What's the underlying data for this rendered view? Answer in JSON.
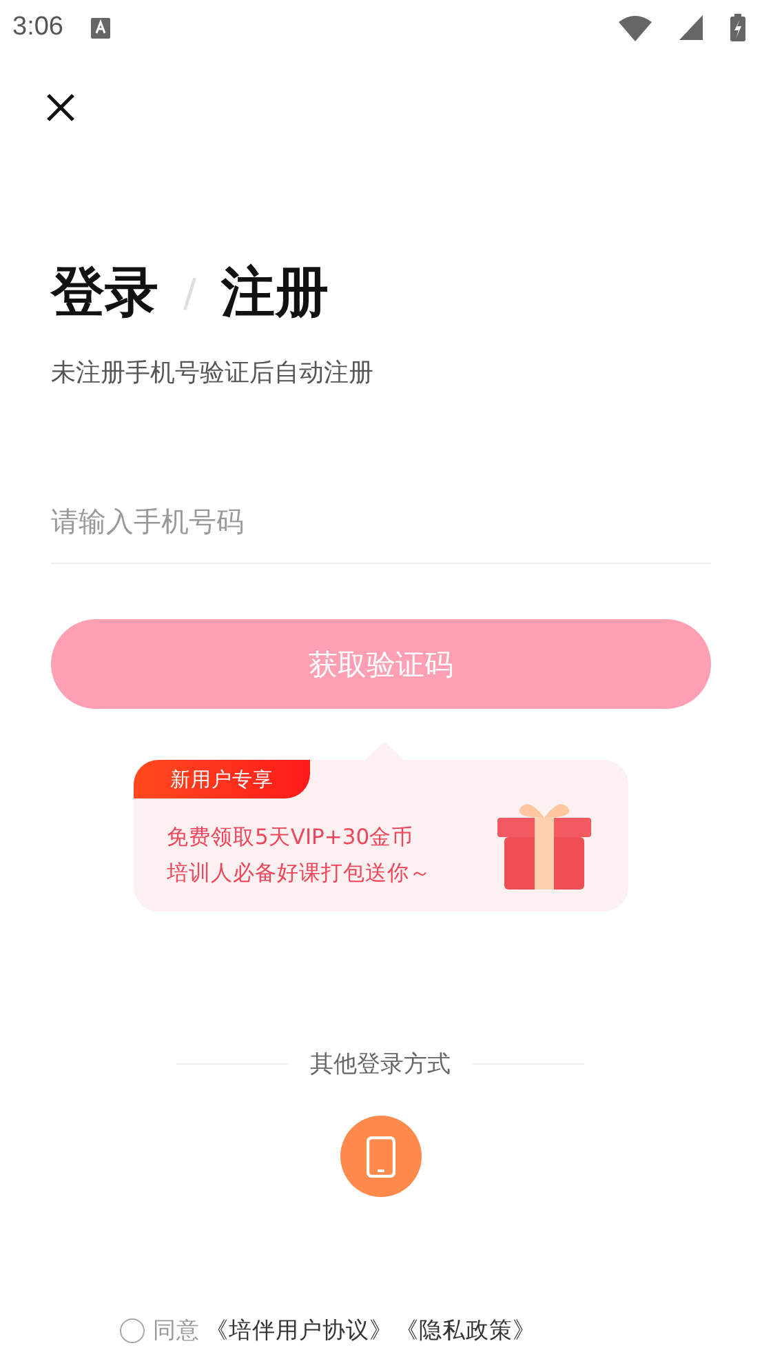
{
  "status_bar": {
    "time": "3:06"
  },
  "title": {
    "login": "登录",
    "separator": "/",
    "register": "注册"
  },
  "subtitle": "未注册手机号验证后自动注册",
  "phone_field": {
    "placeholder": "请输入手机号码"
  },
  "code_button": {
    "label": "获取验证码",
    "disabled": true
  },
  "promo": {
    "tag": "新用户专享",
    "lines": [
      "免费领取5天VIP+30金币",
      "培训人必备好课打包送你～"
    ]
  },
  "other_login": {
    "label": "其他登录方式"
  },
  "agreement": {
    "checked": false,
    "text": "同意",
    "links": [
      "《培伴用户协议》",
      "《隐私政策》"
    ]
  }
}
